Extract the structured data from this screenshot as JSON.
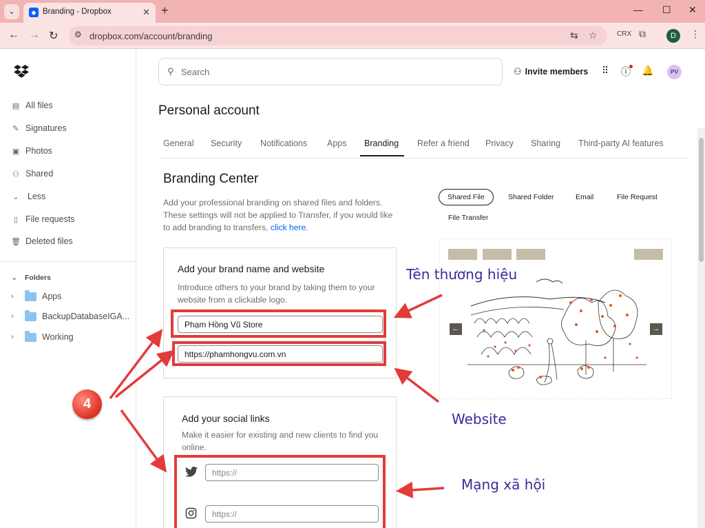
{
  "browser": {
    "tab_title": "Branding - Dropbox",
    "url": "dropbox.com/account/branding",
    "profile_initial": "D",
    "ext_label": "CRX"
  },
  "sidebar": {
    "items": [
      {
        "label": "All files",
        "icon": "all-files-icon"
      },
      {
        "label": "Signatures",
        "icon": "signature-icon"
      },
      {
        "label": "Photos",
        "icon": "photos-icon"
      },
      {
        "label": "Shared",
        "icon": "shared-icon"
      },
      {
        "label": "Less",
        "icon": "chevron-down-icon"
      },
      {
        "label": "File requests",
        "icon": "file-request-icon"
      },
      {
        "label": "Deleted files",
        "icon": "trash-icon"
      }
    ],
    "folders_heading": "Folders",
    "folders": [
      "Apps",
      "BackupDatabaseIGA...",
      "Working"
    ]
  },
  "header": {
    "search_placeholder": "Search",
    "invite_label": "Invite members",
    "avatar_initials": "PV"
  },
  "page": {
    "title": "Personal account",
    "tabs": [
      "General",
      "Security",
      "Notifications",
      "Apps",
      "Branding",
      "Refer a friend",
      "Privacy",
      "Sharing",
      "Third-party AI features"
    ],
    "active_tab": "Branding"
  },
  "branding": {
    "title": "Branding Center",
    "desc_main": "Add your professional branding on shared files and folders. These settings will not be applied to Transfer, if you would like to add branding to transfers,",
    "desc_link": "click here",
    "desc_end": ".",
    "brand_card": {
      "title": "Add your brand name and website",
      "desc": "Introduce others to your brand by taking them to your website from a clickable logo.",
      "name_value": "Phạm Hồng Vũ Store",
      "website_value": "https://phamhongvu.com.vn"
    },
    "social_card": {
      "title": "Add your social links",
      "desc": "Make it easier for existing and new clients to find you online.",
      "twitter_placeholder": "https://",
      "instagram_placeholder": "https://"
    }
  },
  "preview": {
    "pills": [
      "Shared File",
      "Shared Folder",
      "Email",
      "File Request"
    ],
    "pill_second_row": "File Transfer",
    "active_pill": "Shared File",
    "prev_label": "←",
    "next_label": "→"
  },
  "annotations": {
    "brand_label": "Tên thương hiệu",
    "website_label": "Website",
    "social_label": "Mạng xã hội",
    "step_number": "4",
    "arrow_color": "#e23b3b",
    "text_color": "#3a2c99"
  }
}
